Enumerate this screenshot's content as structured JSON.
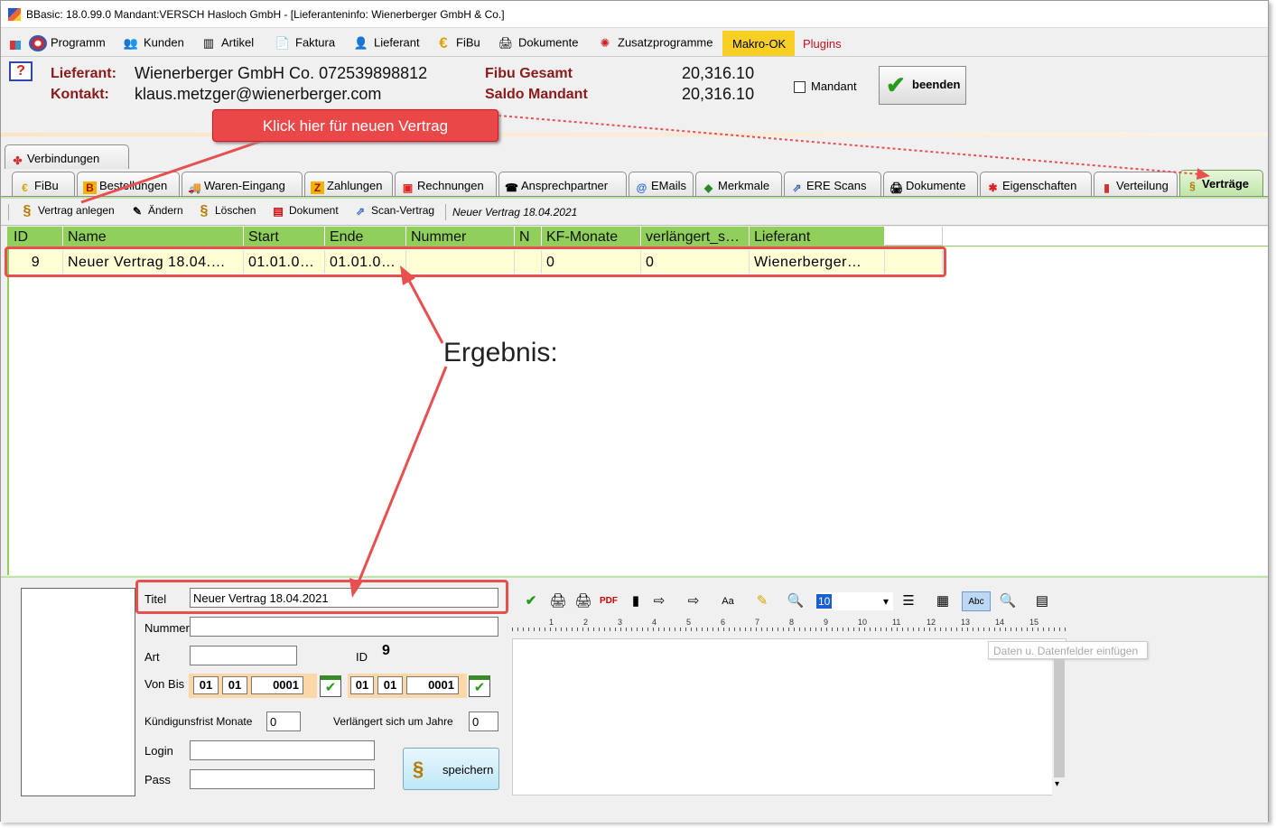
{
  "window": {
    "title": "BBasic: 18.0.99.0 Mandant:VERSCH Hasloch GmbH  - [Lieferanteninfo: Wienerberger GmbH & Co.]"
  },
  "menu": {
    "items": [
      {
        "label": "Programm",
        "icon": "programm-icon"
      },
      {
        "label": "Kunden",
        "icon": "kunden-icon"
      },
      {
        "label": "Artikel",
        "icon": "artikel-icon"
      },
      {
        "label": "Faktura",
        "icon": "faktura-icon"
      },
      {
        "label": "Lieferant",
        "icon": "lieferant-icon"
      },
      {
        "label": "FiBu",
        "icon": "euro-icon"
      },
      {
        "label": "Dokumente",
        "icon": "dokumente-icon"
      },
      {
        "label": "Zusatzprogramme",
        "icon": "zusatzprogramme-icon"
      }
    ],
    "makro": "Makro-OK",
    "plugins": "Plugins"
  },
  "header": {
    "lieferant_label": "Lieferant:",
    "lieferant_value": "Wienerberger GmbH  Co. 072539898812",
    "kontakt_label": "Kontakt:",
    "kontakt_value": "klaus.metzger@wienerberger.com",
    "fibu_label": "Fibu Gesamt",
    "fibu_value": "20,316.10",
    "saldo_label": "Saldo Mandant",
    "saldo_value": "20,316.10",
    "mandant_label": "Mandant",
    "beenden_label": "beenden"
  },
  "annotation": {
    "callout": "Klick hier für neuen Vertrag",
    "ergebnis": "Ergebnis:"
  },
  "tabs": {
    "top": [
      "Verbindungen"
    ],
    "main": [
      "FiBu",
      "Bestellungen",
      "Waren-Eingang",
      "Zahlungen",
      "Rechnungen",
      "Ansprechpartner",
      "EMails",
      "Merkmale",
      "ERE Scans",
      "Dokumente",
      "Eigenschaften",
      "Verteilung",
      "Verträge"
    ],
    "active": "Verträge"
  },
  "toolbar": {
    "anlegen": "Vertrag anlegen",
    "aendern": "Ändern",
    "loeschen": "Löschen",
    "dokument": "Dokument",
    "scan": "Scan-Vertrag",
    "status": "Neuer Vertrag 18.04.2021"
  },
  "grid": {
    "columns": [
      "ID",
      "Name",
      "Start",
      "Ende",
      "Nummer",
      "N",
      "KF-Monate",
      "verlängert_s…",
      "Lieferant"
    ],
    "rows": [
      [
        "9",
        "Neuer  Vertrag  18.04.…",
        "01.01.0…",
        "01.01.0…",
        "",
        "",
        "0",
        "0",
        "Wienerberger…"
      ]
    ]
  },
  "form": {
    "titel_label": "Titel",
    "titel_value": "Neuer Vertrag 18.04.2021",
    "nummer_label": "Nummer",
    "nummer_value": "",
    "art_label": "Art",
    "art_value": "",
    "id_label": "ID",
    "id_value": "9",
    "vonbis_label": "Von Bis",
    "von": {
      "d": "01",
      "m": "01",
      "y": "0001"
    },
    "bis": {
      "d": "01",
      "m": "01",
      "y": "0001"
    },
    "kuendigung_label": "Kündigunsfrist Monate",
    "kuendigung_value": "0",
    "verlaengert_label": "Verlängert sich um Jahre",
    "verlaengert_value": "0",
    "login_label": "Login",
    "login_value": "",
    "pass_label": "Pass",
    "pass_value": "",
    "speichern_label": "speichern"
  },
  "editor": {
    "fontsize": "10",
    "ruler_marks": [
      "1",
      "2",
      "3",
      "4",
      "5",
      "6",
      "7",
      "8",
      "9",
      "10",
      "11",
      "12",
      "13",
      "14",
      "15"
    ],
    "tooltip": "Daten u. Datenfelder einfügen"
  }
}
